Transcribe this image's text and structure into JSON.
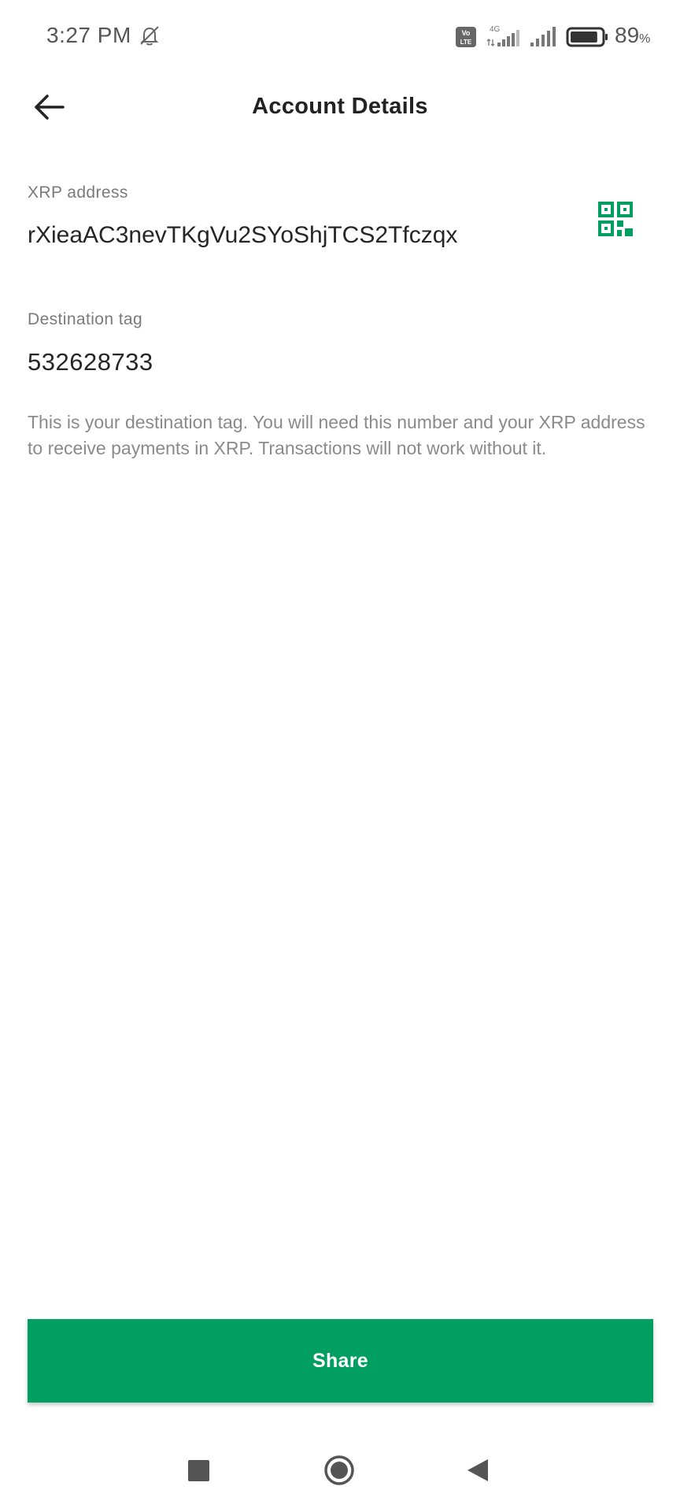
{
  "status_bar": {
    "time": "3:27 PM",
    "battery_number": "89",
    "battery_unit": "%",
    "battery_level": 0.89,
    "icons": [
      "do-not-disturb-icon",
      "volte-icon",
      "signal-4g-icon",
      "signal-icon",
      "battery-icon"
    ]
  },
  "app_bar": {
    "title": "Account Details",
    "back_icon": "arrow-left-icon"
  },
  "xrp_address": {
    "label": "XRP address",
    "value": "rXieaAC3nevTKgVu2SYoShjTCS2Tfczqx",
    "qr_icon": "qr-code-icon"
  },
  "destination_tag": {
    "label": "Destination tag",
    "value": "532628733",
    "info": "This is your destination tag. You will need this number and your XRP address to receive payments in XRP. Transactions will not work without it."
  },
  "share_button": {
    "label": "Share"
  },
  "nav_bar": {
    "icons": [
      "recents-icon",
      "home-icon",
      "back-icon"
    ]
  },
  "colors": {
    "accent": "#009e60",
    "text_primary": "#222222",
    "text_secondary": "#7a7a7a"
  }
}
